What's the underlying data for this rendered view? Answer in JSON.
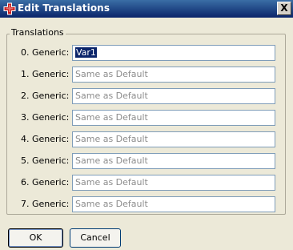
{
  "window": {
    "title": "Edit Translations",
    "close_label": "X",
    "title_icon": "translate-cross-icon"
  },
  "group": {
    "label": "Translations"
  },
  "rows": [
    {
      "label": "0. Generic:",
      "value": "Var1",
      "placeholder": ""
    },
    {
      "label": "1. Generic:",
      "value": "",
      "placeholder": "Same as Default"
    },
    {
      "label": "2. Generic:",
      "value": "",
      "placeholder": "Same as Default"
    },
    {
      "label": "3. Generic:",
      "value": "",
      "placeholder": "Same as Default"
    },
    {
      "label": "4. Generic:",
      "value": "",
      "placeholder": "Same as Default"
    },
    {
      "label": "5. Generic:",
      "value": "",
      "placeholder": "Same as Default"
    },
    {
      "label": "6. Generic:",
      "value": "",
      "placeholder": "Same as Default"
    },
    {
      "label": "7. Generic:",
      "value": "",
      "placeholder": "Same as Default"
    }
  ],
  "buttons": {
    "ok_label": "OK",
    "cancel_label": "Cancel"
  },
  "colors": {
    "title_bar": "#0a246a",
    "selection": "#0a246a",
    "window_bg": "#ece9d8",
    "field_border": "#7f9db9"
  }
}
